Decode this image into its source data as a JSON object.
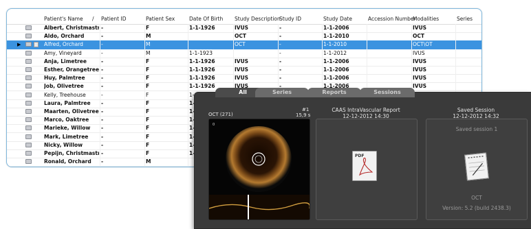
{
  "table": {
    "columns": [
      "Patient's Name",
      "/",
      "Patient ID",
      "Patient Sex",
      "Date Of Birth",
      "Study Description",
      "Study ID",
      "Study Date",
      "Accession Number",
      "Modalities",
      "Series"
    ],
    "rows": [
      {
        "name": "Albert, Christmastree",
        "id": "-",
        "sex": "F",
        "dob": "1-1-1926",
        "desc": "IVUS",
        "sid": "-",
        "date": "1-1-2006",
        "acc": "",
        "mod": "IVUS",
        "bold": true
      },
      {
        "name": "Aldo, Orchard",
        "id": "-",
        "sex": "M",
        "dob": "",
        "desc": "OCT",
        "sid": "-",
        "date": "1-1-2010",
        "acc": "",
        "mod": "OCT",
        "bold": true
      },
      {
        "name": "Alfred, Orchard",
        "id": "-",
        "sex": "M",
        "dob": "",
        "desc": "OCT",
        "sid": "-",
        "date": "1-1-2010",
        "acc": "",
        "mod": "OCT\\OT",
        "bold": false,
        "selected": true
      },
      {
        "name": "Amy, Vineyard",
        "id": "-",
        "sex": "M",
        "dob": "1-1-1923",
        "desc": "",
        "sid": "-",
        "date": "1-1-2012",
        "acc": "",
        "mod": "IVUS",
        "bold": false
      },
      {
        "name": "Anja, Limetree",
        "id": "-",
        "sex": "F",
        "dob": "1-1-1926",
        "desc": "IVUS",
        "sid": "-",
        "date": "1-1-2006",
        "acc": "",
        "mod": "IVUS",
        "bold": true
      },
      {
        "name": "Esther, Orangetree",
        "id": "-",
        "sex": "F",
        "dob": "1-1-1926",
        "desc": "IVUS",
        "sid": "-",
        "date": "1-1-2006",
        "acc": "",
        "mod": "IVUS",
        "bold": true
      },
      {
        "name": "Huy, Palmtree",
        "id": "-",
        "sex": "F",
        "dob": "1-1-1926",
        "desc": "IVUS",
        "sid": "-",
        "date": "1-1-2006",
        "acc": "",
        "mod": "IVUS",
        "bold": true
      },
      {
        "name": "Job, Olivetree",
        "id": "-",
        "sex": "F",
        "dob": "1-1-1926",
        "desc": "IVUS",
        "sid": "-",
        "date": "1-1-2006",
        "acc": "",
        "mod": "IVUS",
        "bold": true
      },
      {
        "name": "Kelly, Treehouse",
        "id": "-",
        "sex": "F",
        "dob": "1-",
        "desc": "",
        "sid": "",
        "date": "",
        "acc": "",
        "mod": "",
        "bold": false
      },
      {
        "name": "Laura, Palmtree",
        "id": "-",
        "sex": "F",
        "dob": "1-",
        "desc": "",
        "sid": "",
        "date": "",
        "acc": "",
        "mod": "",
        "bold": true
      },
      {
        "name": "Maarten, Olivetree",
        "id": "-",
        "sex": "F",
        "dob": "1-",
        "desc": "",
        "sid": "",
        "date": "",
        "acc": "",
        "mod": "",
        "bold": true
      },
      {
        "name": "Marco, Oaktree",
        "id": "-",
        "sex": "F",
        "dob": "1-",
        "desc": "",
        "sid": "",
        "date": "",
        "acc": "",
        "mod": "",
        "bold": true
      },
      {
        "name": "Marieke, Willow",
        "id": "-",
        "sex": "F",
        "dob": "1-",
        "desc": "",
        "sid": "",
        "date": "",
        "acc": "",
        "mod": "",
        "bold": true
      },
      {
        "name": "Mark, Limetree",
        "id": "-",
        "sex": "F",
        "dob": "1-",
        "desc": "",
        "sid": "",
        "date": "",
        "acc": "",
        "mod": "",
        "bold": true
      },
      {
        "name": "Nicky, Willow",
        "id": "-",
        "sex": "F",
        "dob": "1-",
        "desc": "",
        "sid": "",
        "date": "",
        "acc": "",
        "mod": "",
        "bold": true
      },
      {
        "name": "Pepijn, Christmastr...",
        "id": "-",
        "sex": "F",
        "dob": "1-",
        "desc": "",
        "sid": "",
        "date": "",
        "acc": "",
        "mod": "",
        "bold": true
      },
      {
        "name": "Ronald, Orchard",
        "id": "-",
        "sex": "M",
        "dob": "",
        "desc": "",
        "sid": "",
        "date": "",
        "acc": "",
        "mod": "",
        "bold": true
      }
    ]
  },
  "viewer": {
    "tabs": [
      "All",
      "Series",
      "Reports",
      "Sessions"
    ],
    "series": {
      "title": "OCT (271)",
      "frame": "#1",
      "time": "15,9 s"
    },
    "report": {
      "title": "CAAS IntraVascular Report",
      "date": "12-12-2012 14:30",
      "icon_label": "PDF"
    },
    "session": {
      "title": "Saved Session",
      "date": "12-12-2012 14:32",
      "name": "Saved session 1",
      "modality": "OCT",
      "version": "Version: 5.2 (build 2438.3)"
    }
  },
  "colors": {
    "selection": "#3b93e0",
    "panel_border": "#7fb7dc",
    "viewer_bg": "#3a3a3a"
  }
}
